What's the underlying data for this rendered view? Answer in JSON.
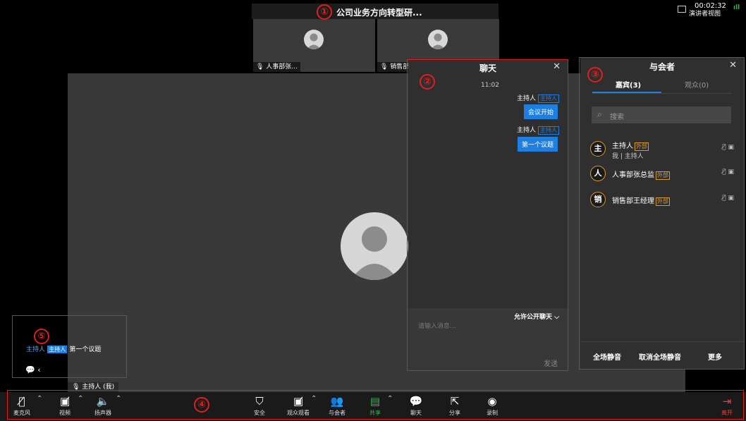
{
  "header": {
    "meeting_title": "公司业务方向转型研...",
    "timer": "00:02:32",
    "speaker_view": "演讲者视图"
  },
  "thumbnails": [
    {
      "name": "人事部张..."
    },
    {
      "name": "销售部"
    }
  ],
  "main": {
    "self_label": "主持人 (我)"
  },
  "chat": {
    "title": "聊天",
    "close": "✕",
    "time": "11:02",
    "messages": [
      {
        "sender": "主持人",
        "tag": "主持人",
        "text": "会议开始"
      },
      {
        "sender": "主持人",
        "tag": "主持人",
        "text": "第一个议题"
      }
    ],
    "allow_public": "允许公开聊天",
    "input_placeholder": "请输入消息...",
    "send": "发送"
  },
  "participants": {
    "title": "与会者",
    "close": "✕",
    "tab_guests": "嘉宾(3)",
    "tab_audience": "观众(0)",
    "search_placeholder": "搜索",
    "list": [
      {
        "avatar": "主",
        "name": "主持人",
        "tag": "外部",
        "sub": "我 | 主持人"
      },
      {
        "avatar": "人",
        "name": "人事部张总监",
        "tag": "外部",
        "sub": ""
      },
      {
        "avatar": "销",
        "name": "销售部王经理",
        "tag": "外部",
        "sub": ""
      }
    ],
    "mute_all": "全场静音",
    "unmute_all": "取消全场静音",
    "more": "更多"
  },
  "float_chat": {
    "sender": "主持人",
    "tag": "主持人",
    "text": "第一个议题"
  },
  "toolbar": {
    "mic": "麦克风",
    "video": "视频",
    "speaker": "扬声器",
    "security": "安全",
    "audience_view": "观众观看",
    "participants": "与会者",
    "share": "共享",
    "chat": "聊天",
    "share2": "分享",
    "record": "录制",
    "leave": "离开"
  },
  "annotations": [
    "①",
    "②",
    "③",
    "④",
    "⑤"
  ],
  "colors": {
    "accent": "#1f7fe0",
    "external_tag": "#d99a2b",
    "share_green": "#3bb34a",
    "leave_red": "#e8413a",
    "annotation_red": "#e01e1e"
  }
}
